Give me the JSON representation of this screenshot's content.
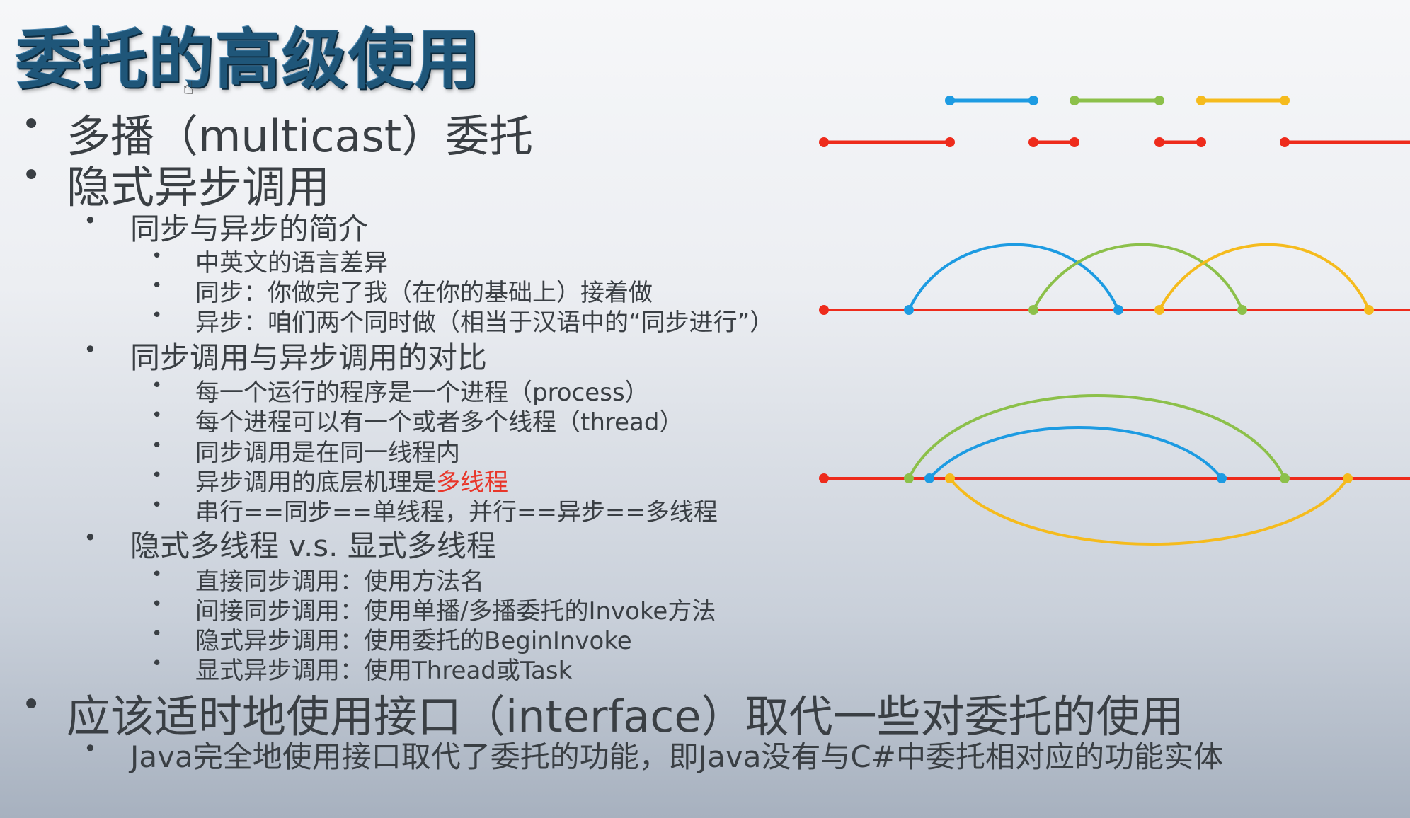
{
  "title": "委托的高级使用",
  "colors": {
    "red": "#ee2b1c",
    "blue": "#1d9be2",
    "green": "#8cc04a",
    "yellow": "#f5bb1d",
    "title": "#1f5679"
  },
  "items": {
    "i0": "多播（multicast）委托",
    "i1": "隐式异步调用",
    "i1_0": "同步与异步的简介",
    "i1_0_0": "中英文的语言差异",
    "i1_0_1": "同步：你做完了我（在你的基础上）接着做",
    "i1_0_2": "异步：咱们两个同时做（相当于汉语中的“同步进行”）",
    "i1_1": "同步调用与异步调用的对比",
    "i1_1_0": "每一个运行的程序是一个进程（process）",
    "i1_1_1": "每个进程可以有一个或者多个线程（thread）",
    "i1_1_2": "同步调用是在同一线程内",
    "i1_1_3_a": "异步调用的底层机理是",
    "i1_1_3_b": "多线程",
    "i1_1_4": "串行==同步==单线程，并行==异步==多线程",
    "i1_2": "隐式多线程 v.s. 显式多线程",
    "i1_2_0": "直接同步调用：使用方法名",
    "i1_2_1": "间接同步调用：使用单播/多播委托的Invoke方法",
    "i1_2_2": "隐式异步调用：使用委托的BeginInvoke",
    "i1_2_3": "显式异步调用：使用Thread或Task",
    "i2": "应该适时地使用接口（interface）取代一些对委托的使用",
    "i2_0": "Java完全地使用接口取代了委托的功能，即Java没有与C#中委托相对应的功能实体"
  },
  "bullet_char": "•",
  "icons": {
    "cursor": "hand-cursor-icon"
  }
}
